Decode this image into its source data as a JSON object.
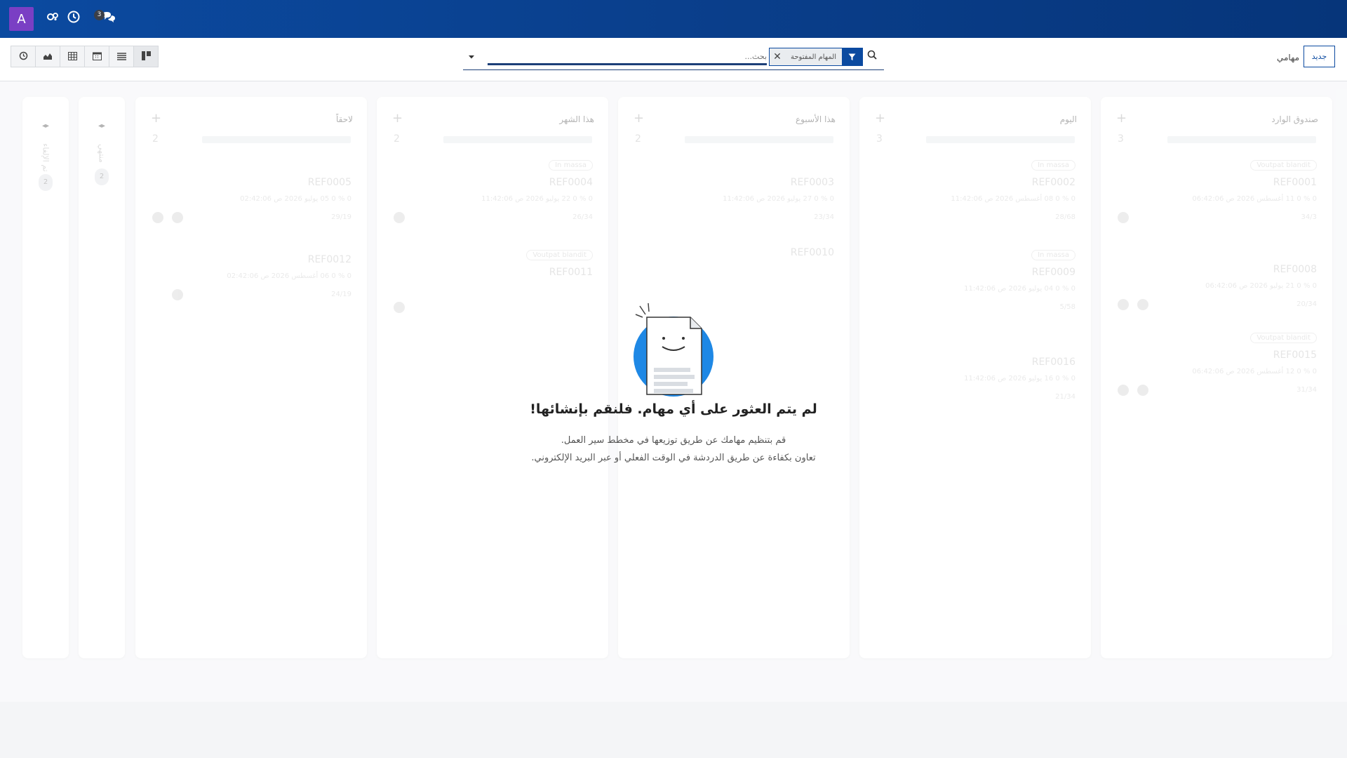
{
  "navbar": {
    "avatar_letter": "A",
    "messages_badge": "3",
    "icons": [
      "activities-icon",
      "clock-icon",
      "chat-icon"
    ]
  },
  "control_panel": {
    "breadcrumb": "مهامي",
    "new_button": "جديد",
    "search": {
      "placeholder": "بحث...",
      "facet_value": "المهام المفتوحة",
      "facet_icon": "filter-icon"
    },
    "views": [
      "activity-view",
      "graph-view",
      "pivot-view",
      "calendar-view",
      "list-view",
      "kanban-view"
    ]
  },
  "columns": [
    {
      "title": "صندوق الوارد",
      "count": "3",
      "cards": [
        {
          "tag": "Voutpat blandit",
          "ref": "REF0001",
          "meta": "0 %   0   11 أغسطس 2026 ص 06:42:06",
          "foot": "34/3"
        },
        {
          "tag": "",
          "ref": "REF0008",
          "meta": "0 %   0   21 يوليو 2026 ص 06:42:06",
          "foot": "20/34"
        },
        {
          "tag": "Voutpat blandit",
          "ref": "REF0015",
          "meta": "0 %   0   12 أغسطس 2026 ص 06:42:06",
          "foot": "31/34"
        }
      ]
    },
    {
      "title": "اليوم",
      "count": "3",
      "cards": [
        {
          "tag": "In massa",
          "ref": "REF0002",
          "meta": "0 %   0   08 أغسطس 2026 ص 11:42:06",
          "foot": "28/68"
        },
        {
          "tag": "In massa",
          "ref": "REF0009",
          "meta": "0 %   0   04 يوليو 2026 ص 11:42:06",
          "foot": "5/58"
        },
        {
          "tag": "",
          "ref": "REF0016",
          "meta": "0 %   0   16 يوليو 2026 ص 11:42:06",
          "foot": "21/34"
        }
      ]
    },
    {
      "title": "هذا الأسبوع",
      "count": "2",
      "cards": [
        {
          "tag": "",
          "ref": "REF0003",
          "meta": "0 %   0   27 يوليو 2026 ص 11:42:06",
          "foot": "23/34"
        },
        {
          "tag": "",
          "ref": "REF0010",
          "meta": "",
          "foot": ""
        }
      ]
    },
    {
      "title": "هذا الشهر",
      "count": "2",
      "cards": [
        {
          "tag": "In massa",
          "ref": "REF0004",
          "meta": "0 %   0   22 يوليو 2026 ص 11:42:06",
          "foot": "26/34"
        },
        {
          "tag": "Voutpat blandit",
          "ref": "REF0011",
          "meta": "",
          "foot": ""
        }
      ]
    },
    {
      "title": "لاحقاً",
      "count": "2",
      "cards": [
        {
          "tag": "",
          "ref": "REF0005",
          "meta": "0 %   0   05 يوليو 2026 ص 02:42:06",
          "foot": "29/19"
        },
        {
          "tag": "",
          "ref": "REF0012",
          "meta": "0 %   0   06 أغسطس 2026 ص 02:42:06",
          "foot": "24/19"
        }
      ]
    }
  ],
  "folded_columns": [
    {
      "title": "منتهي",
      "count": "2"
    },
    {
      "title": "تم الإلغاء",
      "count": "2"
    }
  ],
  "helper": {
    "title": "لم يتم العثور على أي مهام. فلنقم بإنشائها!",
    "line1": "قم بتنظيم مهامك عن طريق توزيعها في مخطط سير العمل.",
    "line2": "تعاون بكفاءة عن طريق الدردشة في الوقت الفعلي أو عبر البريد الإلكتروني."
  },
  "colors": {
    "navbar": "#0b4aa0",
    "avatar": "#7a3fc4",
    "accent": "#0b4aa0",
    "illustration": "#1e88e5"
  }
}
